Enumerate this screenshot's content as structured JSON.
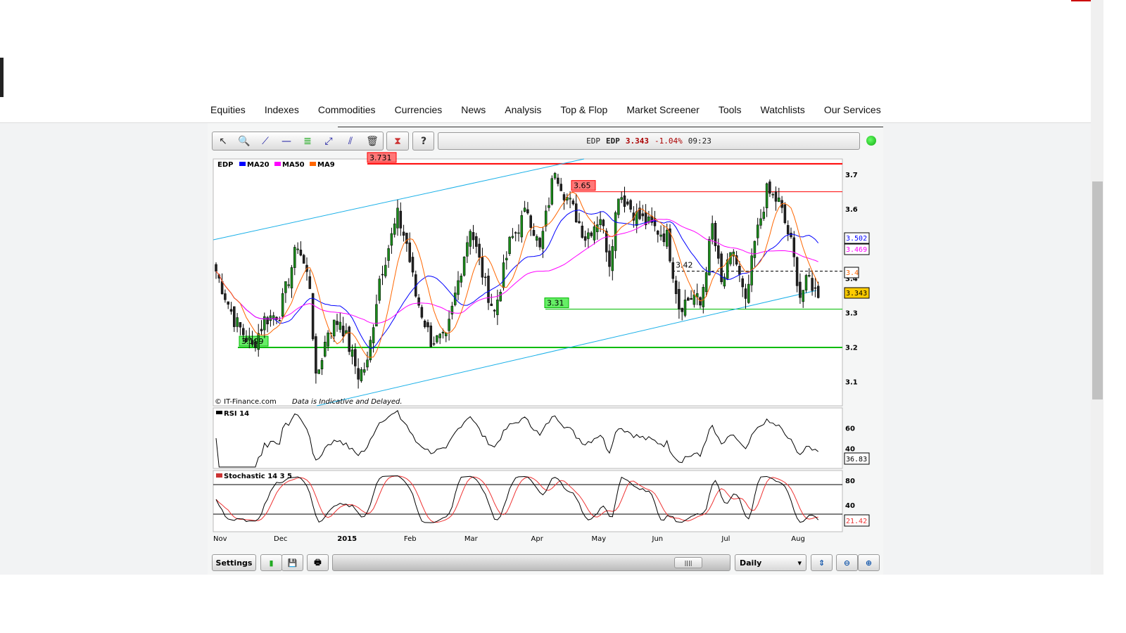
{
  "nav": [
    "Equities",
    "Indexes",
    "Commodities",
    "Currencies",
    "News",
    "Analysis",
    "Top & Flop",
    "Market Screener",
    "Tools",
    "Watchlists",
    "Our Services"
  ],
  "quote": {
    "code": "EDP",
    "name": "EDP",
    "price": "3.343",
    "change": "-1.04%",
    "time": "09:23"
  },
  "legend": {
    "symbol": "EDP",
    "items": [
      {
        "label": "MA20",
        "color": "#0000ff"
      },
      {
        "label": "MA50",
        "color": "#ff00ff"
      },
      {
        "label": "MA9",
        "color": "#ff6600"
      }
    ]
  },
  "credits": {
    "source": "© IT-Finance.com",
    "disclaimer": "Data is Indicative and Delayed."
  },
  "indicators": {
    "rsi_label": "RSI 14",
    "rsi_value": "36.83",
    "stoch_label": "Stochastic 14 3 5",
    "stoch_value": "21.42"
  },
  "right_labels": {
    "ma20": "3.502",
    "ma50": "3.469",
    "ma9": "3.4",
    "last": "3.343"
  },
  "bottom": {
    "settings": "Settings",
    "period": "Daily"
  },
  "chart_data": {
    "type": "candlestick",
    "x_ticks": [
      "Nov",
      "Dec",
      "2015",
      "Feb",
      "Mar",
      "Apr",
      "May",
      "Jun",
      "Jul",
      "Aug"
    ],
    "x_tick_days": [
      0,
      20,
      41,
      63,
      83,
      105,
      125,
      145,
      168,
      191
    ],
    "y_ticks": [
      3.1,
      3.2,
      3.3,
      3.4,
      3.6,
      3.7
    ],
    "ylim": [
      3.03,
      3.745
    ],
    "levels": [
      {
        "value": 3.731,
        "label": "3.731",
        "color": "#ff0000"
      },
      {
        "value": 3.65,
        "label": "3.65",
        "color": "#ff0000"
      },
      {
        "value": 3.31,
        "label": "3.31",
        "color": "#00bb00"
      },
      {
        "value": 3.199,
        "label": "3.199",
        "color": "#00bb00"
      },
      {
        "value": 3.42,
        "label": "3.42",
        "color": "#000000",
        "dashed": true
      }
    ],
    "rsi_ticks": [
      60,
      40
    ],
    "stoch_ticks": [
      80,
      40
    ],
    "close_waypoints": [
      [
        0,
        3.42
      ],
      [
        3,
        3.35
      ],
      [
        6,
        3.28
      ],
      [
        12,
        3.2
      ],
      [
        16,
        3.28
      ],
      [
        21,
        3.3
      ],
      [
        27,
        3.5
      ],
      [
        31,
        3.38
      ],
      [
        33,
        3.1
      ],
      [
        37,
        3.25
      ],
      [
        41,
        3.28
      ],
      [
        47,
        3.12
      ],
      [
        50,
        3.15
      ],
      [
        54,
        3.4
      ],
      [
        60,
        3.58
      ],
      [
        63,
        3.5
      ],
      [
        66,
        3.35
      ],
      [
        71,
        3.22
      ],
      [
        76,
        3.22
      ],
      [
        79,
        3.35
      ],
      [
        84,
        3.55
      ],
      [
        89,
        3.38
      ],
      [
        92,
        3.3
      ],
      [
        97,
        3.5
      ],
      [
        103,
        3.6
      ],
      [
        107,
        3.48
      ],
      [
        112,
        3.72
      ],
      [
        115,
        3.65
      ],
      [
        119,
        3.58
      ],
      [
        122,
        3.52
      ],
      [
        127,
        3.58
      ],
      [
        130,
        3.45
      ],
      [
        133,
        3.65
      ],
      [
        139,
        3.58
      ],
      [
        144,
        3.55
      ],
      [
        149,
        3.52
      ],
      [
        153,
        3.32
      ],
      [
        158,
        3.35
      ],
      [
        160,
        3.32
      ],
      [
        164,
        3.55
      ],
      [
        167,
        3.38
      ],
      [
        171,
        3.48
      ],
      [
        175,
        3.32
      ],
      [
        178,
        3.5
      ],
      [
        182,
        3.65
      ],
      [
        186,
        3.62
      ],
      [
        190,
        3.5
      ],
      [
        193,
        3.35
      ],
      [
        196,
        3.4
      ],
      [
        199,
        3.343
      ]
    ]
  }
}
